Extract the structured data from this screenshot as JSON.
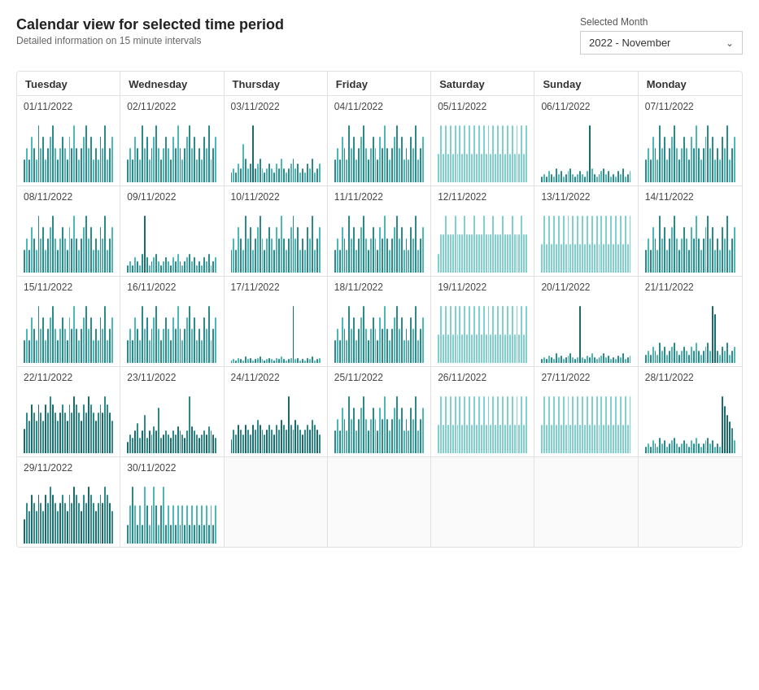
{
  "header": {
    "title": "Calendar view for selected time period",
    "subtitle": "Detailed information on 15 minute intervals",
    "selected_month_label": "Selected Month",
    "selected_month_value": "2022 - November"
  },
  "day_names": [
    "Tuesday",
    "Wednesday",
    "Thursday",
    "Friday",
    "Saturday",
    "Sunday",
    "Monday"
  ],
  "weeks": [
    {
      "days": [
        {
          "date": "01/11/2022",
          "has_data": true,
          "style": "normal"
        },
        {
          "date": "02/11/2022",
          "has_data": true,
          "style": "normal"
        },
        {
          "date": "03/11/2022",
          "has_data": true,
          "style": "spike"
        },
        {
          "date": "04/11/2022",
          "has_data": true,
          "style": "normal"
        },
        {
          "date": "05/11/2022",
          "has_data": true,
          "style": "light"
        },
        {
          "date": "06/11/2022",
          "has_data": true,
          "style": "spike2"
        },
        {
          "date": "07/11/2022",
          "has_data": true,
          "style": "normal"
        }
      ]
    },
    {
      "days": [
        {
          "date": "08/11/2022",
          "has_data": true,
          "style": "normal"
        },
        {
          "date": "09/11/2022",
          "has_data": true,
          "style": "spike3"
        },
        {
          "date": "10/11/2022",
          "has_data": true,
          "style": "normal"
        },
        {
          "date": "11/11/2022",
          "has_data": true,
          "style": "normal"
        },
        {
          "date": "12/11/2022",
          "has_data": true,
          "style": "light2"
        },
        {
          "date": "13/11/2022",
          "has_data": true,
          "style": "light"
        },
        {
          "date": "14/11/2022",
          "has_data": true,
          "style": "normal"
        }
      ]
    },
    {
      "days": [
        {
          "date": "15/11/2022",
          "has_data": true,
          "style": "normal"
        },
        {
          "date": "16/11/2022",
          "has_data": true,
          "style": "normal"
        },
        {
          "date": "17/11/2022",
          "has_data": true,
          "style": "bigspike"
        },
        {
          "date": "18/11/2022",
          "has_data": true,
          "style": "normal"
        },
        {
          "date": "19/11/2022",
          "has_data": true,
          "style": "light3"
        },
        {
          "date": "20/11/2022",
          "has_data": true,
          "style": "spike4"
        },
        {
          "date": "21/11/2022",
          "has_data": true,
          "style": "spike5"
        }
      ]
    },
    {
      "days": [
        {
          "date": "22/11/2022",
          "has_data": true,
          "style": "dense"
        },
        {
          "date": "23/11/2022",
          "has_data": true,
          "style": "dense2"
        },
        {
          "date": "24/11/2022",
          "has_data": true,
          "style": "dense3"
        },
        {
          "date": "25/11/2022",
          "has_data": true,
          "style": "normal"
        },
        {
          "date": "26/11/2022",
          "has_data": true,
          "style": "light4"
        },
        {
          "date": "27/11/2022",
          "has_data": true,
          "style": "light5"
        },
        {
          "date": "28/11/2022",
          "has_data": true,
          "style": "spike6"
        }
      ]
    },
    {
      "days": [
        {
          "date": "29/11/2022",
          "has_data": true,
          "style": "dense4"
        },
        {
          "date": "30/11/2022",
          "has_data": true,
          "style": "small"
        },
        {
          "date": "",
          "has_data": false,
          "style": "empty"
        },
        {
          "date": "",
          "has_data": false,
          "style": "empty"
        },
        {
          "date": "",
          "has_data": false,
          "style": "empty"
        },
        {
          "date": "",
          "has_data": false,
          "style": "empty"
        },
        {
          "date": "",
          "has_data": false,
          "style": "empty"
        }
      ]
    }
  ],
  "colors": {
    "bar_dark": "#2d8a8a",
    "bar_light": "#80d0d0",
    "bar_medium": "#4db8b8",
    "bg": "#ffffff",
    "border": "#e0e0e0"
  }
}
